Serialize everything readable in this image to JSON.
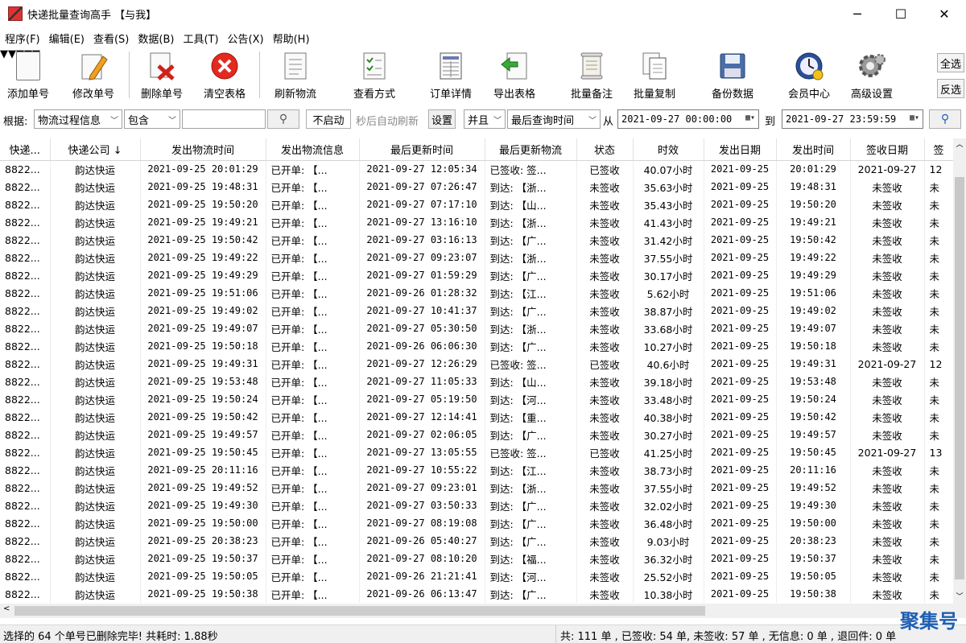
{
  "window": {
    "title": "快递批量查询高手 【与我】",
    "min": "─",
    "max": "☐",
    "close": "✕"
  },
  "menu": [
    "程序(F)",
    "编辑(E)",
    "查看(S)",
    "数据(B)",
    "工具(T)",
    "公告(X)",
    "帮助(H)"
  ],
  "toolbar": {
    "add": "添加单号",
    "edit": "修改单号",
    "delete": "删除单号",
    "clear": "清空表格",
    "refresh": "刷新物流",
    "view": "查看方式",
    "detail": "订单详情",
    "export": "导出表格",
    "note": "批量备注",
    "copy": "批量复制",
    "backup": "备份数据",
    "member": "会员中心",
    "settings": "高级设置",
    "select_all": "全选",
    "invert": "反选"
  },
  "filter": {
    "basis_label": "根据:",
    "field": "物流过程信息",
    "op": "包含",
    "keyword": "",
    "auto_btn": "不启动",
    "auto_text": "秒后自动刷新",
    "set_btn": "设置",
    "logic": "并且",
    "time_field": "最后查询时间",
    "from_label": "从",
    "from_value": "2021-09-27 00:00:00",
    "to_label": "到",
    "to_value": "2021-09-27 23:59:59"
  },
  "table": {
    "columns": [
      "快递...",
      "快递公司 ↓",
      "发出物流时间",
      "发出物流信息",
      "最后更新时间",
      "最后更新物流",
      "状态",
      "时效",
      "发出日期",
      "发出时间",
      "签收日期",
      "签"
    ],
    "rows": [
      [
        "8822...",
        "韵达快运",
        "2021-09-25 20:01:29",
        "已开单: 【...",
        "2021-09-27 12:05:34",
        "已签收: 签...",
        "已签收",
        "40.07小时",
        "2021-09-25",
        "20:01:29",
        "2021-09-27",
        "12"
      ],
      [
        "8822...",
        "韵达快运",
        "2021-09-25 19:48:31",
        "已开单: 【...",
        "2021-09-27 07:26:47",
        "到达: 【浙...",
        "未签收",
        "35.63小时",
        "2021-09-25",
        "19:48:31",
        "未签收",
        "未"
      ],
      [
        "8822...",
        "韵达快运",
        "2021-09-25 19:50:20",
        "已开单: 【...",
        "2021-09-27 07:17:10",
        "到达: 【山...",
        "未签收",
        "35.43小时",
        "2021-09-25",
        "19:50:20",
        "未签收",
        "未"
      ],
      [
        "8822...",
        "韵达快运",
        "2021-09-25 19:49:21",
        "已开单: 【...",
        "2021-09-27 13:16:10",
        "到达: 【浙...",
        "未签收",
        "41.43小时",
        "2021-09-25",
        "19:49:21",
        "未签收",
        "未"
      ],
      [
        "8822...",
        "韵达快运",
        "2021-09-25 19:50:42",
        "已开单: 【...",
        "2021-09-27 03:16:13",
        "到达: 【广...",
        "未签收",
        "31.42小时",
        "2021-09-25",
        "19:50:42",
        "未签收",
        "未"
      ],
      [
        "8822...",
        "韵达快运",
        "2021-09-25 19:49:22",
        "已开单: 【...",
        "2021-09-27 09:23:07",
        "到达: 【浙...",
        "未签收",
        "37.55小时",
        "2021-09-25",
        "19:49:22",
        "未签收",
        "未"
      ],
      [
        "8822...",
        "韵达快运",
        "2021-09-25 19:49:29",
        "已开单: 【...",
        "2021-09-27 01:59:29",
        "到达: 【广...",
        "未签收",
        "30.17小时",
        "2021-09-25",
        "19:49:29",
        "未签收",
        "未"
      ],
      [
        "8822...",
        "韵达快运",
        "2021-09-25 19:51:06",
        "已开单: 【...",
        "2021-09-26 01:28:32",
        "到达: 【江...",
        "未签收",
        "5.62小时",
        "2021-09-25",
        "19:51:06",
        "未签收",
        "未"
      ],
      [
        "8822...",
        "韵达快运",
        "2021-09-25 19:49:02",
        "已开单: 【...",
        "2021-09-27 10:41:37",
        "到达: 【广...",
        "未签收",
        "38.87小时",
        "2021-09-25",
        "19:49:02",
        "未签收",
        "未"
      ],
      [
        "8822...",
        "韵达快运",
        "2021-09-25 19:49:07",
        "已开单: 【...",
        "2021-09-27 05:30:50",
        "到达: 【浙...",
        "未签收",
        "33.68小时",
        "2021-09-25",
        "19:49:07",
        "未签收",
        "未"
      ],
      [
        "8822...",
        "韵达快运",
        "2021-09-25 19:50:18",
        "已开单: 【...",
        "2021-09-26 06:06:30",
        "到达: 【广...",
        "未签收",
        "10.27小时",
        "2021-09-25",
        "19:50:18",
        "未签收",
        "未"
      ],
      [
        "8822...",
        "韵达快运",
        "2021-09-25 19:49:31",
        "已开单: 【...",
        "2021-09-27 12:26:29",
        "已签收: 签...",
        "已签收",
        "40.6小时",
        "2021-09-25",
        "19:49:31",
        "2021-09-27",
        "12"
      ],
      [
        "8822...",
        "韵达快运",
        "2021-09-25 19:53:48",
        "已开单: 【...",
        "2021-09-27 11:05:33",
        "到达: 【山...",
        "未签收",
        "39.18小时",
        "2021-09-25",
        "19:53:48",
        "未签收",
        "未"
      ],
      [
        "8822...",
        "韵达快运",
        "2021-09-25 19:50:24",
        "已开单: 【...",
        "2021-09-27 05:19:50",
        "到达: 【河...",
        "未签收",
        "33.48小时",
        "2021-09-25",
        "19:50:24",
        "未签收",
        "未"
      ],
      [
        "8822...",
        "韵达快运",
        "2021-09-25 19:50:42",
        "已开单: 【...",
        "2021-09-27 12:14:41",
        "到达: 【重...",
        "未签收",
        "40.38小时",
        "2021-09-25",
        "19:50:42",
        "未签收",
        "未"
      ],
      [
        "8822...",
        "韵达快运",
        "2021-09-25 19:49:57",
        "已开单: 【...",
        "2021-09-27 02:06:05",
        "到达: 【广...",
        "未签收",
        "30.27小时",
        "2021-09-25",
        "19:49:57",
        "未签收",
        "未"
      ],
      [
        "8822...",
        "韵达快运",
        "2021-09-25 19:50:45",
        "已开单: 【...",
        "2021-09-27 13:05:55",
        "已签收: 签...",
        "已签收",
        "41.25小时",
        "2021-09-25",
        "19:50:45",
        "2021-09-27",
        "13"
      ],
      [
        "8822...",
        "韵达快运",
        "2021-09-25 20:11:16",
        "已开单: 【...",
        "2021-09-27 10:55:22",
        "到达: 【江...",
        "未签收",
        "38.73小时",
        "2021-09-25",
        "20:11:16",
        "未签收",
        "未"
      ],
      [
        "8822...",
        "韵达快运",
        "2021-09-25 19:49:52",
        "已开单: 【...",
        "2021-09-27 09:23:01",
        "到达: 【浙...",
        "未签收",
        "37.55小时",
        "2021-09-25",
        "19:49:52",
        "未签收",
        "未"
      ],
      [
        "8822...",
        "韵达快运",
        "2021-09-25 19:49:30",
        "已开单: 【...",
        "2021-09-27 03:50:33",
        "到达: 【广...",
        "未签收",
        "32.02小时",
        "2021-09-25",
        "19:49:30",
        "未签收",
        "未"
      ],
      [
        "8822...",
        "韵达快运",
        "2021-09-25 19:50:00",
        "已开单: 【...",
        "2021-09-27 08:19:08",
        "到达: 【广...",
        "未签收",
        "36.48小时",
        "2021-09-25",
        "19:50:00",
        "未签收",
        "未"
      ],
      [
        "8822...",
        "韵达快运",
        "2021-09-25 20:38:23",
        "已开单: 【...",
        "2021-09-26 05:40:27",
        "到达: 【广...",
        "未签收",
        "9.03小时",
        "2021-09-25",
        "20:38:23",
        "未签收",
        "未"
      ],
      [
        "8822...",
        "韵达快运",
        "2021-09-25 19:50:37",
        "已开单: 【...",
        "2021-09-27 08:10:20",
        "到达: 【福...",
        "未签收",
        "36.32小时",
        "2021-09-25",
        "19:50:37",
        "未签收",
        "未"
      ],
      [
        "8822...",
        "韵达快运",
        "2021-09-25 19:50:05",
        "已开单: 【...",
        "2021-09-26 21:21:41",
        "到达: 【河...",
        "未签收",
        "25.52小时",
        "2021-09-25",
        "19:50:05",
        "未签收",
        "未"
      ],
      [
        "8822...",
        "韵达快运",
        "2021-09-25 19:50:38",
        "已开单: 【...",
        "2021-09-26 06:13:47",
        "到达: 【广...",
        "未签收",
        "10.38小时",
        "2021-09-25",
        "19:50:38",
        "未签收",
        "未"
      ]
    ]
  },
  "status": {
    "left": "选择的 64 个单号已删除完毕! 共耗时: 1.88秒",
    "right": "共: 111 单 , 已签收:  54 单, 未签收:  57 单 , 无信息: 0 单 , 退回件: 0 单"
  },
  "watermark": "聚集号"
}
